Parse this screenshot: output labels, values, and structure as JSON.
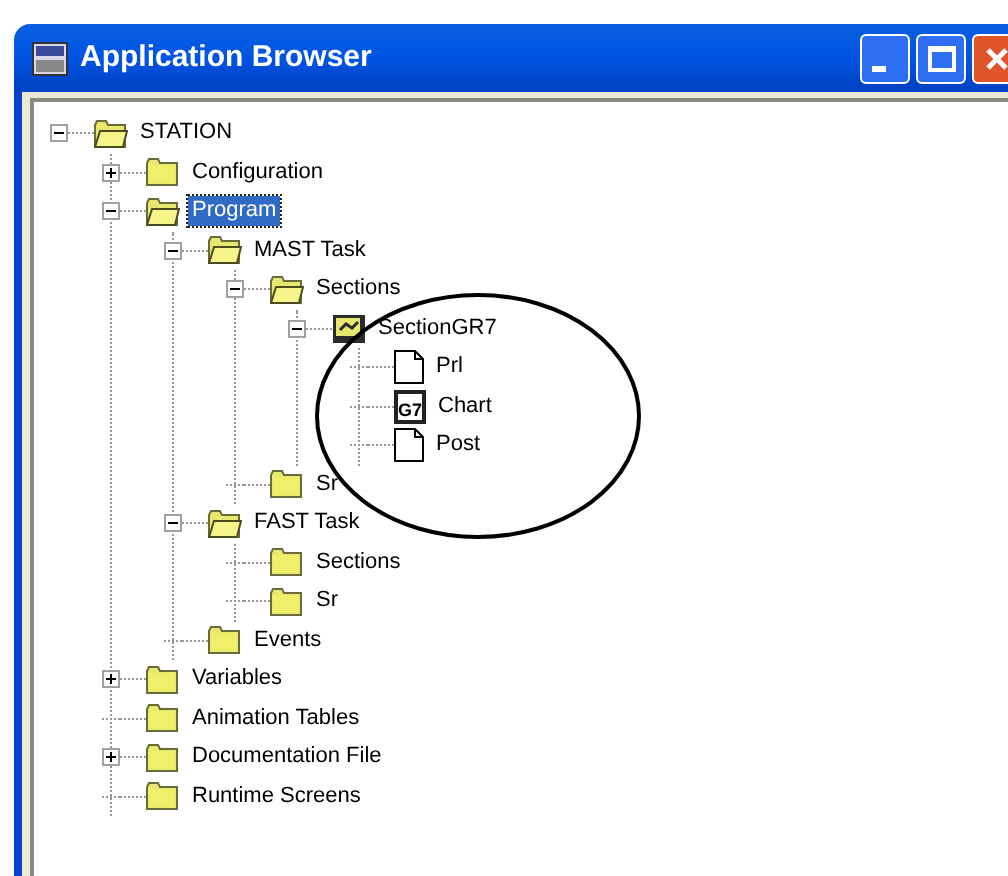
{
  "window": {
    "title": "Application Browser"
  },
  "tree": [
    {
      "label": "STATION",
      "kind": "open-folder",
      "expanded": true,
      "selected": false,
      "children": [
        {
          "label": "Configuration",
          "kind": "folder",
          "expanded": false,
          "selected": false
        },
        {
          "label": "Program",
          "kind": "open-folder",
          "expanded": true,
          "selected": true,
          "children": [
            {
              "label": "MAST Task",
              "kind": "open-folder",
              "expanded": true,
              "selected": false,
              "children": [
                {
                  "label": "Sections",
                  "kind": "open-folder",
                  "expanded": true,
                  "selected": false,
                  "children": [
                    {
                      "label": "SectionGR7",
                      "kind": "section",
                      "expanded": true,
                      "selected": false,
                      "children": [
                        {
                          "label": "Prl",
                          "kind": "page",
                          "selected": false
                        },
                        {
                          "label": "Chart",
                          "kind": "chart",
                          "icon_text": "G7",
                          "selected": false
                        },
                        {
                          "label": "Post",
                          "kind": "page",
                          "selected": false
                        }
                      ]
                    }
                  ]
                },
                {
                  "label": "Sr",
                  "kind": "folder",
                  "selected": false
                }
              ]
            },
            {
              "label": "FAST Task",
              "kind": "open-folder",
              "expanded": true,
              "selected": false,
              "children": [
                {
                  "label": "Sections",
                  "kind": "folder",
                  "selected": false
                },
                {
                  "label": "Sr",
                  "kind": "folder",
                  "selected": false
                }
              ]
            },
            {
              "label": "Events",
              "kind": "folder",
              "selected": false
            }
          ]
        },
        {
          "label": "Variables",
          "kind": "folder",
          "expanded": false,
          "selected": false
        },
        {
          "label": "Animation Tables",
          "kind": "folder",
          "selected": false
        },
        {
          "label": "Documentation File",
          "kind": "folder",
          "expanded": false,
          "selected": false
        },
        {
          "label": "Runtime Screens",
          "kind": "folder",
          "selected": false
        }
      ]
    }
  ]
}
